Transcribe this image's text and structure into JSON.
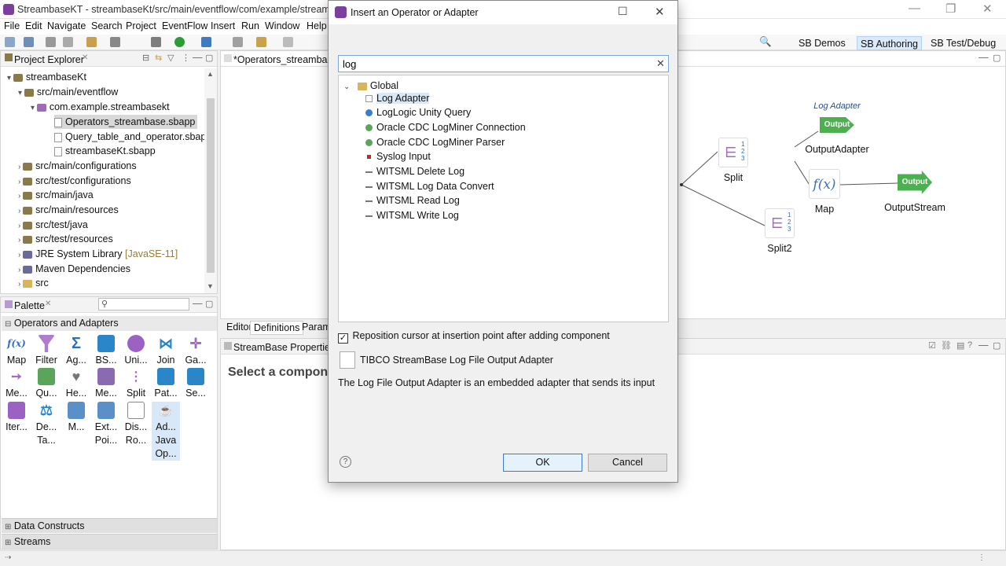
{
  "window": {
    "title": "StreambaseKT - streambaseKt/src/main/eventflow/com/example/streambas"
  },
  "menu": [
    "File",
    "Edit",
    "Navigate",
    "Search",
    "Project",
    "EventFlow",
    "Insert",
    "Run",
    "Window",
    "Help"
  ],
  "perspectives": [
    "SB Demos",
    "SB Authoring",
    "SB Test/Debug"
  ],
  "project_explorer": {
    "title": "Project Explorer",
    "items": [
      {
        "label": "streambaseKt"
      },
      {
        "label": "src/main/eventflow"
      },
      {
        "label": "com.example.streambasekt"
      },
      {
        "label": "Operators_streambase.sbapp"
      },
      {
        "label": "Query_table_and_operator.sbapp"
      },
      {
        "label": "streambaseKt.sbapp"
      },
      {
        "label": "src/main/configurations"
      },
      {
        "label": "src/test/configurations"
      },
      {
        "label": "src/main/java"
      },
      {
        "label": "src/main/resources"
      },
      {
        "label": "src/test/java"
      },
      {
        "label": "src/test/resources"
      },
      {
        "label": "JRE System Library",
        "suffix": "[JavaSE-11]"
      },
      {
        "label": "Maven Dependencies"
      },
      {
        "label": "src"
      }
    ]
  },
  "palette": {
    "title": "Palette",
    "section": "Operators and Adapters",
    "items": [
      {
        "label": "Map",
        "icon": "f(x)"
      },
      {
        "label": "Filter",
        "icon": "filter-icon"
      },
      {
        "label": "Ag...",
        "icon": "Σ"
      },
      {
        "label": "BS...",
        "icon": "bs-icon"
      },
      {
        "label": "Uni...",
        "icon": "union-icon"
      },
      {
        "label": "Join",
        "icon": "join-icon"
      },
      {
        "label": "Ga...",
        "icon": "gather-icon"
      },
      {
        "label": "Me...",
        "icon": "merge-icon"
      },
      {
        "label": "Qu...",
        "icon": "query-icon"
      },
      {
        "label": "He...",
        "icon": "heartbeat-icon"
      },
      {
        "label": "Me...",
        "icon": "metronome-icon"
      },
      {
        "label": "Split",
        "icon": "split-icon"
      },
      {
        "label": "Pat...",
        "icon": "pattern-icon"
      },
      {
        "label": "Se...",
        "icon": "sequence-icon"
      },
      {
        "label": "Iter...",
        "icon": "iterate-icon"
      },
      {
        "label": "De... Ta...",
        "icon": "decision-table-icon"
      },
      {
        "label": "M...",
        "icon": "model-icon"
      },
      {
        "label": "Ext... Poi...",
        "icon": "extension-point-icon"
      },
      {
        "label": "Dis... Ro...",
        "icon": "distributed-router-icon"
      },
      {
        "label": "Ad... Java Op...",
        "icon": "java-operator-icon"
      }
    ],
    "bottom_sections": [
      "Data Constructs",
      "Streams"
    ]
  },
  "editor": {
    "tab": "*Operators_streambase",
    "bottom_tabs": [
      "Editor",
      "Definitions",
      "Parame"
    ],
    "properties_title": "StreamBase Properties",
    "properties_msg": "Select a compone"
  },
  "canvas": {
    "nodes": [
      {
        "label": "Split"
      },
      {
        "label": "Split2"
      },
      {
        "label": "Map",
        "icon": "f(x)"
      },
      {
        "label": "OutputAdapter",
        "badge": "Output",
        "annotation": "Log Adapter"
      },
      {
        "label": "OutputStream",
        "badge": "Output"
      }
    ]
  },
  "dialog": {
    "title": "Insert an Operator or Adapter",
    "search_value": "log",
    "group": "Global",
    "results": [
      {
        "label": "Log Adapter",
        "color": "#ffffff",
        "selected": true
      },
      {
        "label": "LogLogic Unity Query",
        "color": "#3a7bd5"
      },
      {
        "label": "Oracle CDC LogMiner Connection",
        "color": "#5aa55a"
      },
      {
        "label": "Oracle CDC LogMiner Parser",
        "color": "#5aa55a"
      },
      {
        "label": "Syslog Input",
        "color": "#cc2222"
      },
      {
        "label": "WITSML Delete Log",
        "color": "#777777"
      },
      {
        "label": "WITSML Log Data Convert",
        "color": "#777777"
      },
      {
        "label": "WITSML Read Log",
        "color": "#777777"
      },
      {
        "label": "WITSML Write Log",
        "color": "#777777"
      }
    ],
    "checkbox_label": "Reposition cursor at insertion point after adding component",
    "component_name": "TIBCO StreamBase Log File Output Adapter",
    "description": "The Log File Output Adapter is an embedded adapter that sends its input",
    "ok": "OK",
    "cancel": "Cancel",
    "help": "?"
  }
}
